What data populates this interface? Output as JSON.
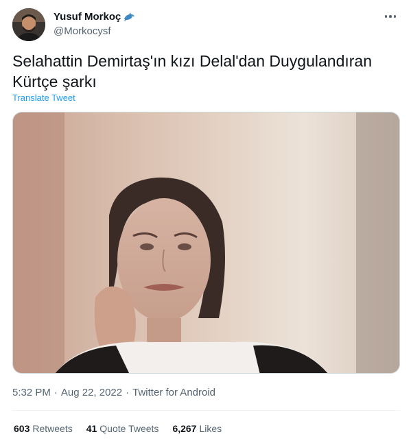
{
  "author": {
    "display_name": "Yusuf Morkoç",
    "handle": "@Morkocysf",
    "badge_icon": "dolphin-emoji-icon"
  },
  "tweet": {
    "text": "Selahattin Demirtaş'ın kızı Delal'dan  Duygulandıran Kürtçe şarkı",
    "translate_label": "Translate Tweet",
    "time": "5:32 PM",
    "date": "Aug 22, 2022",
    "separator": "·",
    "source": "Twitter for Android"
  },
  "stats": {
    "retweets_count": "603",
    "retweets_label": "Retweets",
    "quotes_count": "41",
    "quotes_label": "Quote Tweets",
    "likes_count": "6,267",
    "likes_label": "Likes"
  },
  "colors": {
    "accent": "#1d9bf0",
    "secondary_text": "#536471",
    "primary_text": "#0f1419"
  }
}
